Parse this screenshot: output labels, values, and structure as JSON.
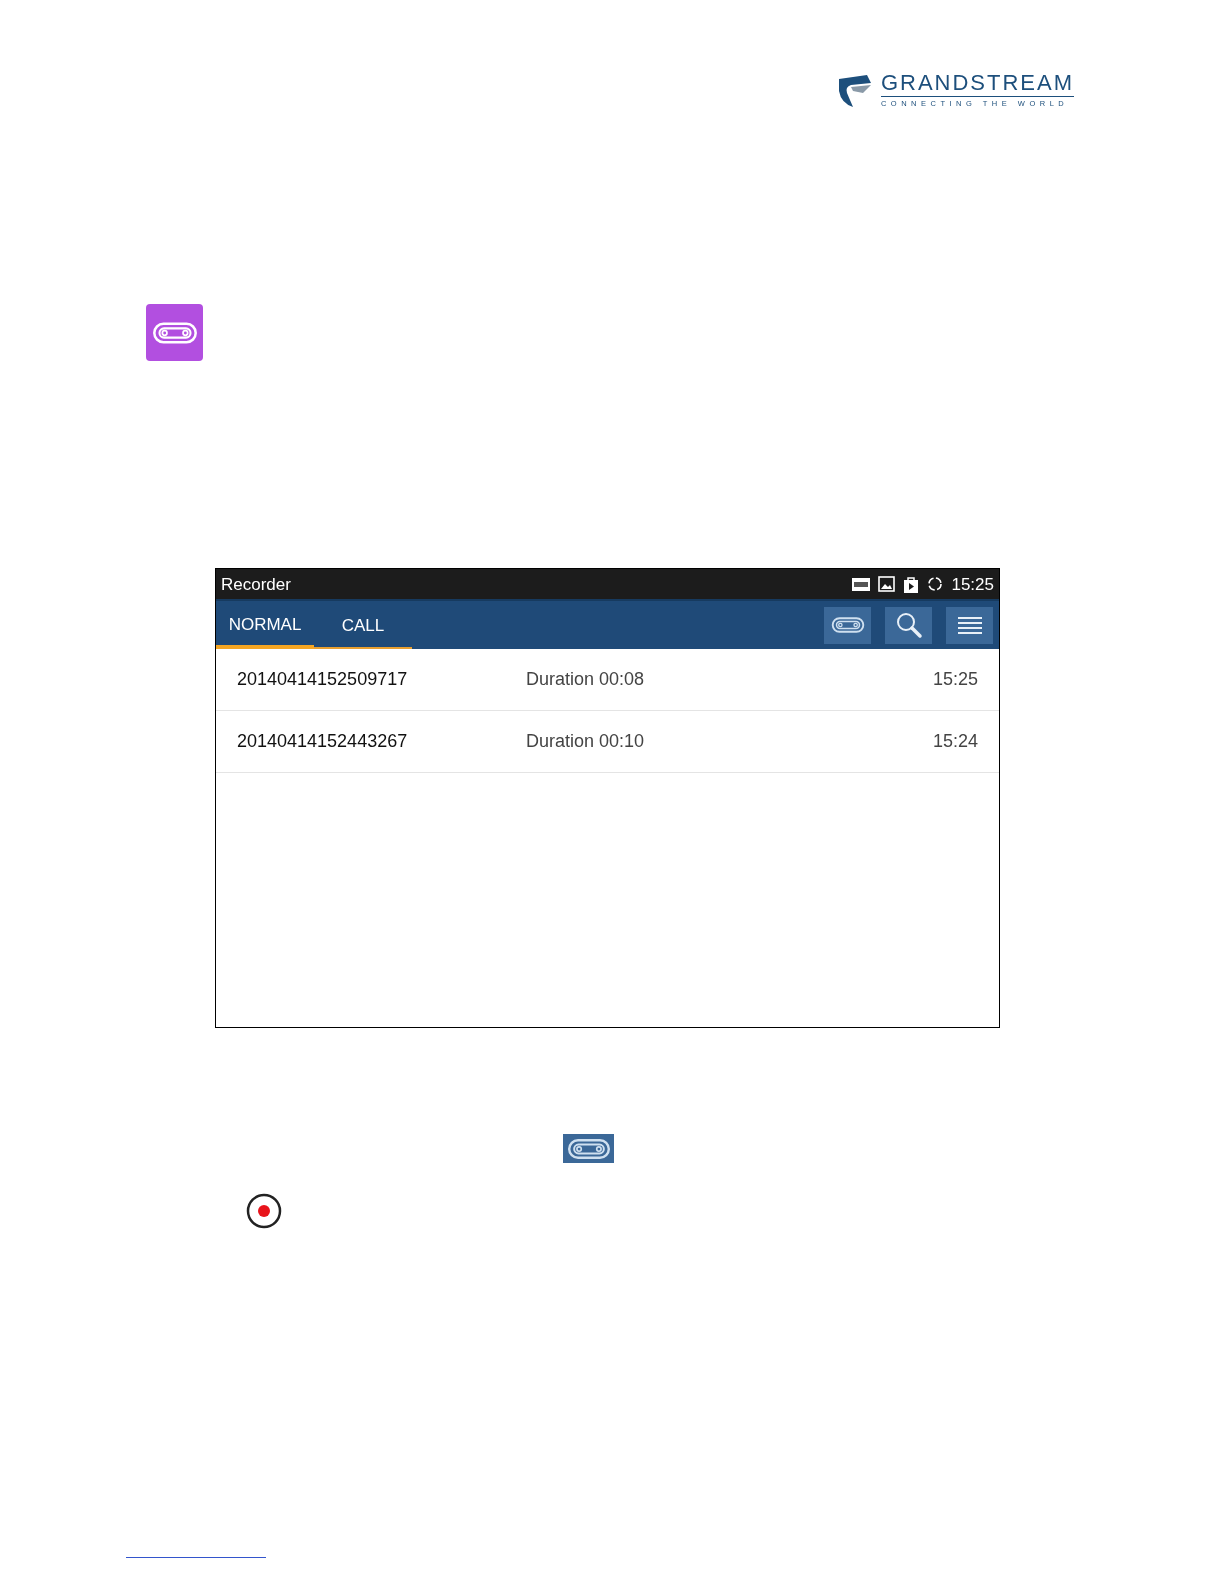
{
  "logo": {
    "name": "GRANDSTREAM",
    "tagline": "CONNECTING THE WORLD"
  },
  "screen": {
    "status_bar": {
      "title": "Recorder",
      "time": "15:25"
    },
    "tabs": [
      {
        "label": "NORMAL",
        "selected": true
      },
      {
        "label": "CALL",
        "selected": false
      }
    ],
    "recordings": [
      {
        "name": "20140414152509717",
        "duration": "Duration 00:08",
        "time": "15:25"
      },
      {
        "name": "20140414152443267",
        "duration": "Duration 00:10",
        "time": "15:24"
      }
    ]
  }
}
